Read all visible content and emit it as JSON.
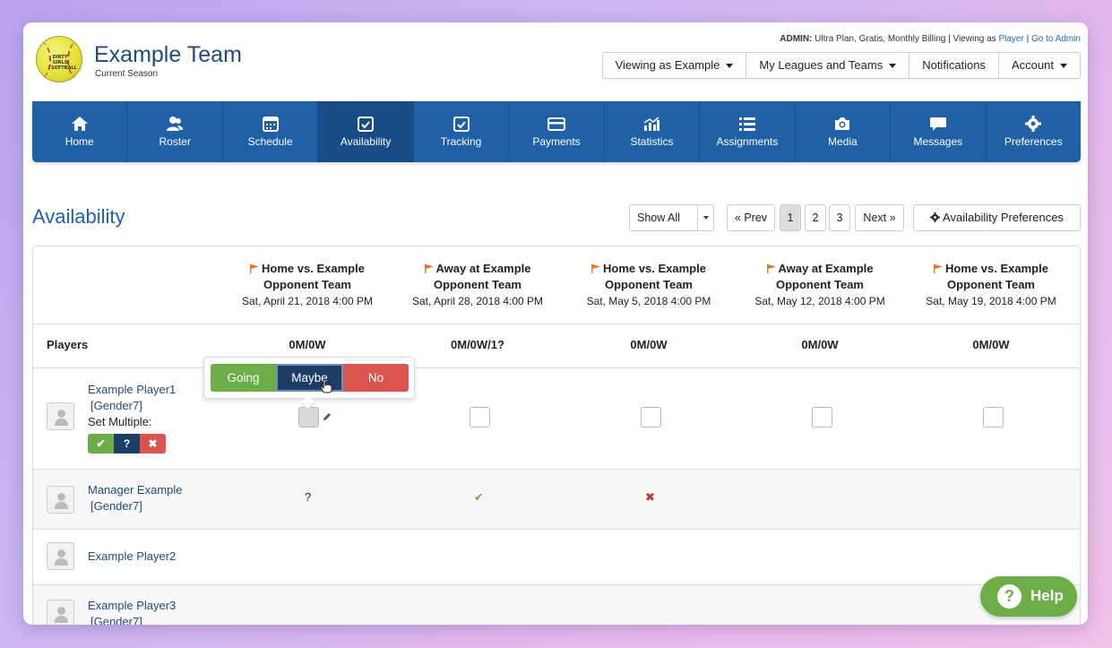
{
  "header": {
    "team_name": "Example Team",
    "season": "Current Season",
    "admin_label": "ADMIN:",
    "admin_plan": "Ultra Plan, Gratis, Monthly Billing | Viewing as",
    "admin_viewing_role": "Player",
    "admin_sep": "|",
    "admin_goto": "Go to Admin",
    "menu": {
      "viewing_as": "Viewing as Example",
      "leagues": "My Leagues and Teams",
      "notifications": "Notifications",
      "account": "Account"
    }
  },
  "nav": [
    {
      "label": "Home",
      "icon": "home-icon"
    },
    {
      "label": "Roster",
      "icon": "roster-icon"
    },
    {
      "label": "Schedule",
      "icon": "calendar-icon"
    },
    {
      "label": "Availability",
      "icon": "availability-icon"
    },
    {
      "label": "Tracking",
      "icon": "tracking-icon"
    },
    {
      "label": "Payments",
      "icon": "credit-card-icon"
    },
    {
      "label": "Statistics",
      "icon": "statistics-icon"
    },
    {
      "label": "Assignments",
      "icon": "list-icon"
    },
    {
      "label": "Media",
      "icon": "camera-icon"
    },
    {
      "label": "Messages",
      "icon": "message-icon"
    },
    {
      "label": "Preferences",
      "icon": "gear-icon"
    }
  ],
  "page": {
    "title": "Availability",
    "filter_value": "Show All",
    "prev": "« Prev",
    "pages": [
      "1",
      "2",
      "3"
    ],
    "next": "Next »",
    "preferences_button": "Availability Preferences"
  },
  "table": {
    "players_header": "Players",
    "events": [
      {
        "title": "Home vs. Example",
        "opponent": "Opponent Team",
        "date": "Sat, April 21, 2018 4:00 PM",
        "count": "0M/0W"
      },
      {
        "title": "Away at Example",
        "opponent": "Opponent Team",
        "date": "Sat, April 28, 2018 4:00 PM",
        "count": "0M/0W/1?"
      },
      {
        "title": "Home vs. Example",
        "opponent": "Opponent Team",
        "date": "Sat, May 5, 2018 4:00 PM",
        "count": "0M/0W"
      },
      {
        "title": "Away at Example",
        "opponent": "Opponent Team",
        "date": "Sat, May 12, 2018 4:00 PM",
        "count": "0M/0W"
      },
      {
        "title": "Home vs. Example",
        "opponent": "Opponent Team",
        "date": "Sat, May 19, 2018 4:00 PM",
        "count": "0M/0W"
      }
    ],
    "players": [
      {
        "name": "Example Player1",
        "gender": "[Gender7]"
      },
      {
        "name": "Manager Example",
        "gender": "[Gender7]"
      },
      {
        "name": "Example Player2",
        "gender": ""
      },
      {
        "name": "Example Player3",
        "gender": "[Gender7]"
      }
    ],
    "set_multiple": "Set Multiple:",
    "multi_buttons": {
      "yes": "✔",
      "maybe": "?",
      "no": "✖"
    },
    "manager_marks": {
      "e1": "?",
      "e2": "✔",
      "e3": "✖"
    }
  },
  "popup": {
    "going": "Going",
    "maybe": "Maybe",
    "no": "No"
  },
  "help": {
    "label": "Help"
  },
  "colors": {
    "brand_blue": "#1f60a6",
    "going_green": "#6cae45",
    "maybe_navy": "#1d3d66",
    "no_red": "#d9534f",
    "flag_orange": "#e07b2a"
  }
}
